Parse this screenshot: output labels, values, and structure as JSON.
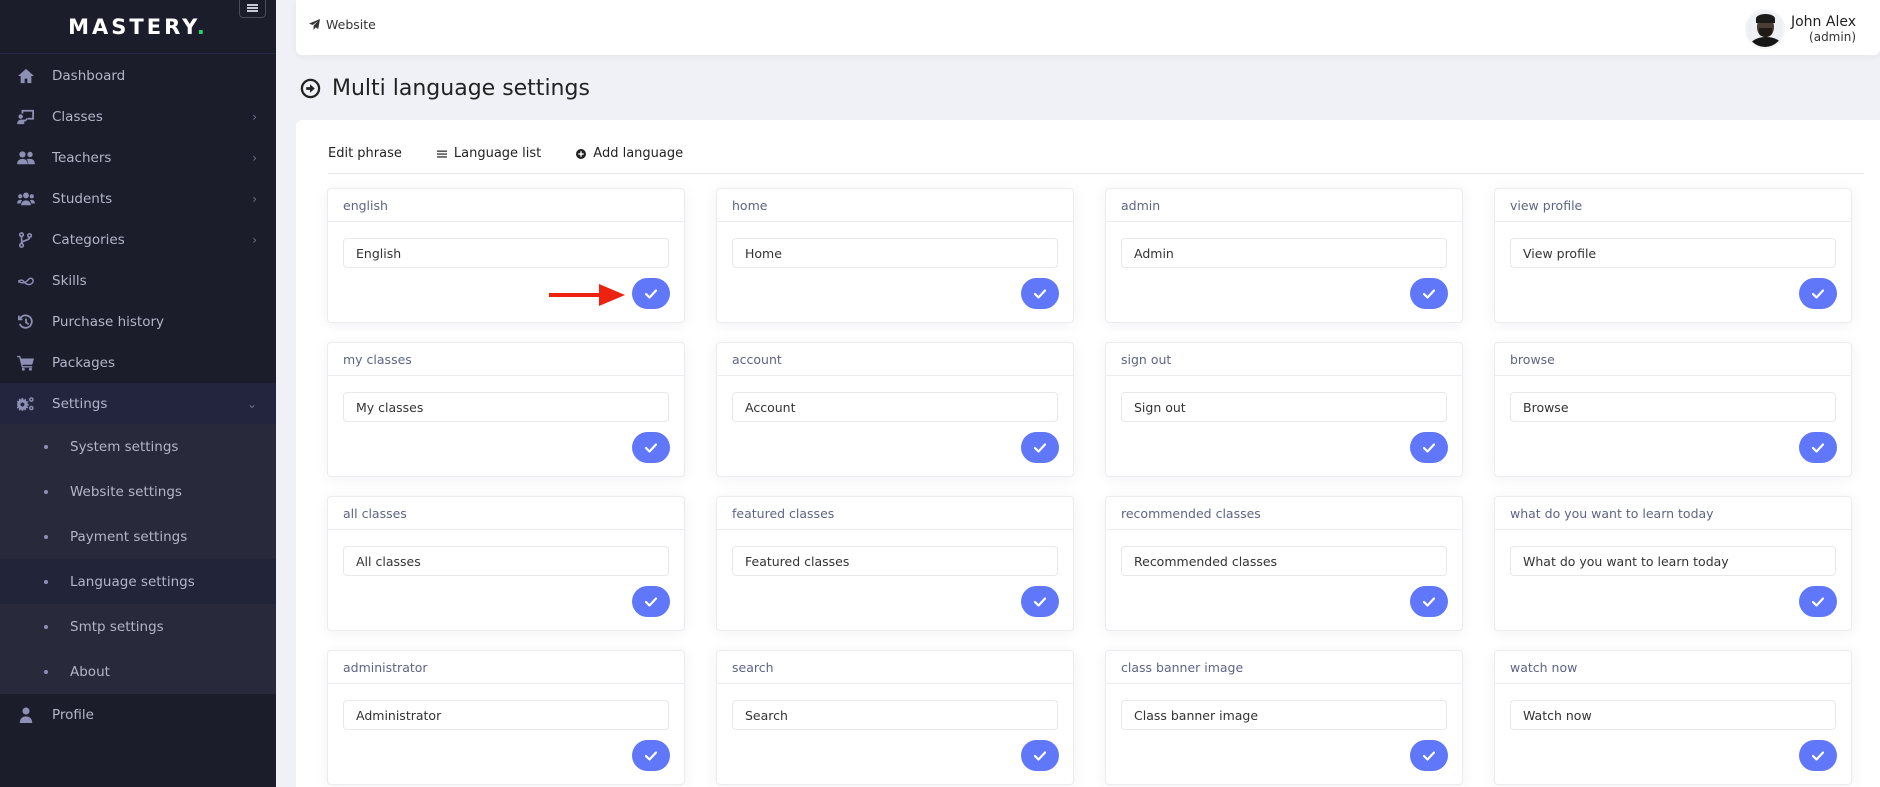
{
  "sidebar": {
    "brand": "MASTERY",
    "brand_dot": ".",
    "items": [
      {
        "label": "Dashboard",
        "icon": "home-icon",
        "has_children": false
      },
      {
        "label": "Classes",
        "icon": "chalkboard-teacher-icon",
        "has_children": true
      },
      {
        "label": "Teachers",
        "icon": "user-friends-icon",
        "has_children": true
      },
      {
        "label": "Students",
        "icon": "users-icon",
        "has_children": true
      },
      {
        "label": "Categories",
        "icon": "code-branch-icon",
        "has_children": true
      },
      {
        "label": "Skills",
        "icon": "infinity-icon",
        "has_children": false
      },
      {
        "label": "Purchase history",
        "icon": "history-icon",
        "has_children": false
      },
      {
        "label": "Packages",
        "icon": "shopping-cart-icon",
        "has_children": false
      },
      {
        "label": "Settings",
        "icon": "cogs-icon",
        "has_children": true,
        "expanded": true
      },
      {
        "label": "Profile",
        "icon": "user-icon",
        "has_children": false
      }
    ],
    "settings_submenu": [
      {
        "label": "System settings"
      },
      {
        "label": "Website settings"
      },
      {
        "label": "Payment settings"
      },
      {
        "label": "Language settings",
        "current": true
      },
      {
        "label": "Smtp settings"
      },
      {
        "label": "About"
      }
    ]
  },
  "header": {
    "website_link": "Website",
    "user_name": "John Alex",
    "user_role": "(admin)"
  },
  "page": {
    "title": "Multi language settings"
  },
  "tabs": [
    {
      "label": "Edit phrase",
      "icon": null
    },
    {
      "label": "Language list",
      "icon": "list-icon"
    },
    {
      "label": "Add language",
      "icon": "plus-circle-icon"
    }
  ],
  "phrases": [
    {
      "key": "english",
      "value": "English"
    },
    {
      "key": "home",
      "value": "Home"
    },
    {
      "key": "admin",
      "value": "Admin"
    },
    {
      "key": "view profile",
      "value": "View profile"
    },
    {
      "key": "my classes",
      "value": "My classes"
    },
    {
      "key": "account",
      "value": "Account"
    },
    {
      "key": "sign out",
      "value": "Sign out"
    },
    {
      "key": "browse",
      "value": "Browse"
    },
    {
      "key": "all classes",
      "value": "All classes"
    },
    {
      "key": "featured classes",
      "value": "Featured classes"
    },
    {
      "key": "recommended classes",
      "value": "Recommended classes"
    },
    {
      "key": "what do you want to learn today",
      "value": "What do you want to learn today"
    },
    {
      "key": "administrator",
      "value": "Administrator"
    },
    {
      "key": "search",
      "value": "Search"
    },
    {
      "key": "class banner image",
      "value": "Class banner image"
    },
    {
      "key": "watch now",
      "value": "Watch now"
    }
  ],
  "colors": {
    "sidebar_bg": "#1c1d2b",
    "accent": "#6077fa",
    "brand_dot": "#22d36e",
    "annotation": "#ee2211"
  }
}
